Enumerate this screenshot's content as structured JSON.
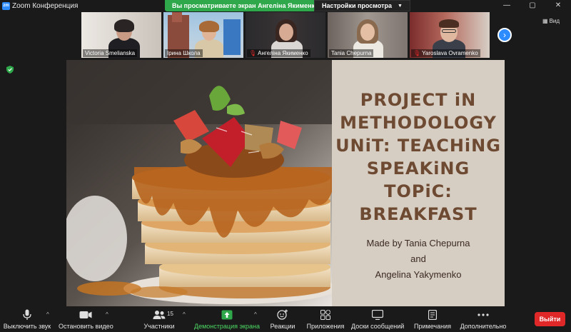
{
  "window": {
    "title": "Zoom Конференция",
    "controls": [
      "—",
      "▢",
      "✕"
    ]
  },
  "share_banner": {
    "text": "Вы просматриваете экран Ангеліна Якименко",
    "view_settings": "Настройки просмотра"
  },
  "participants": [
    {
      "name": "Victoria Smelianska",
      "muted": false
    },
    {
      "name": "Ірина Школа",
      "muted": false,
      "active_speaker": true
    },
    {
      "name": "Ангеліна Якименко",
      "muted": true
    },
    {
      "name": "Tania Chepurna",
      "muted": false
    },
    {
      "name": "Yaroslava Ovramenko",
      "muted": true
    }
  ],
  "view_button": "Вид",
  "slide": {
    "title_lines": [
      "PROJECT iN",
      "METHODOLOGY",
      "UNiT: TEACHiNG",
      "SPEAKiNG",
      "TOPiC: BREAKFAST"
    ],
    "subtitle_lines": [
      "Made by Tania Chepurna",
      "and",
      "Angelina Yakymenko"
    ]
  },
  "toolbar": {
    "mute": "Выключить звук",
    "video": "Остановить видео",
    "participants": "Участники",
    "participants_count": "15",
    "share": "Демонстрация экрана",
    "reactions": "Реакции",
    "apps": "Приложения",
    "whiteboards": "Доски сообщений",
    "notes": "Примечания",
    "more": "Дополнительно",
    "leave": "Выйти"
  },
  "colors": {
    "share_green": "#2ea84a",
    "accent_blue": "#2d8cff",
    "leave_red": "#e02828",
    "slide_title": "#6e4a32"
  }
}
